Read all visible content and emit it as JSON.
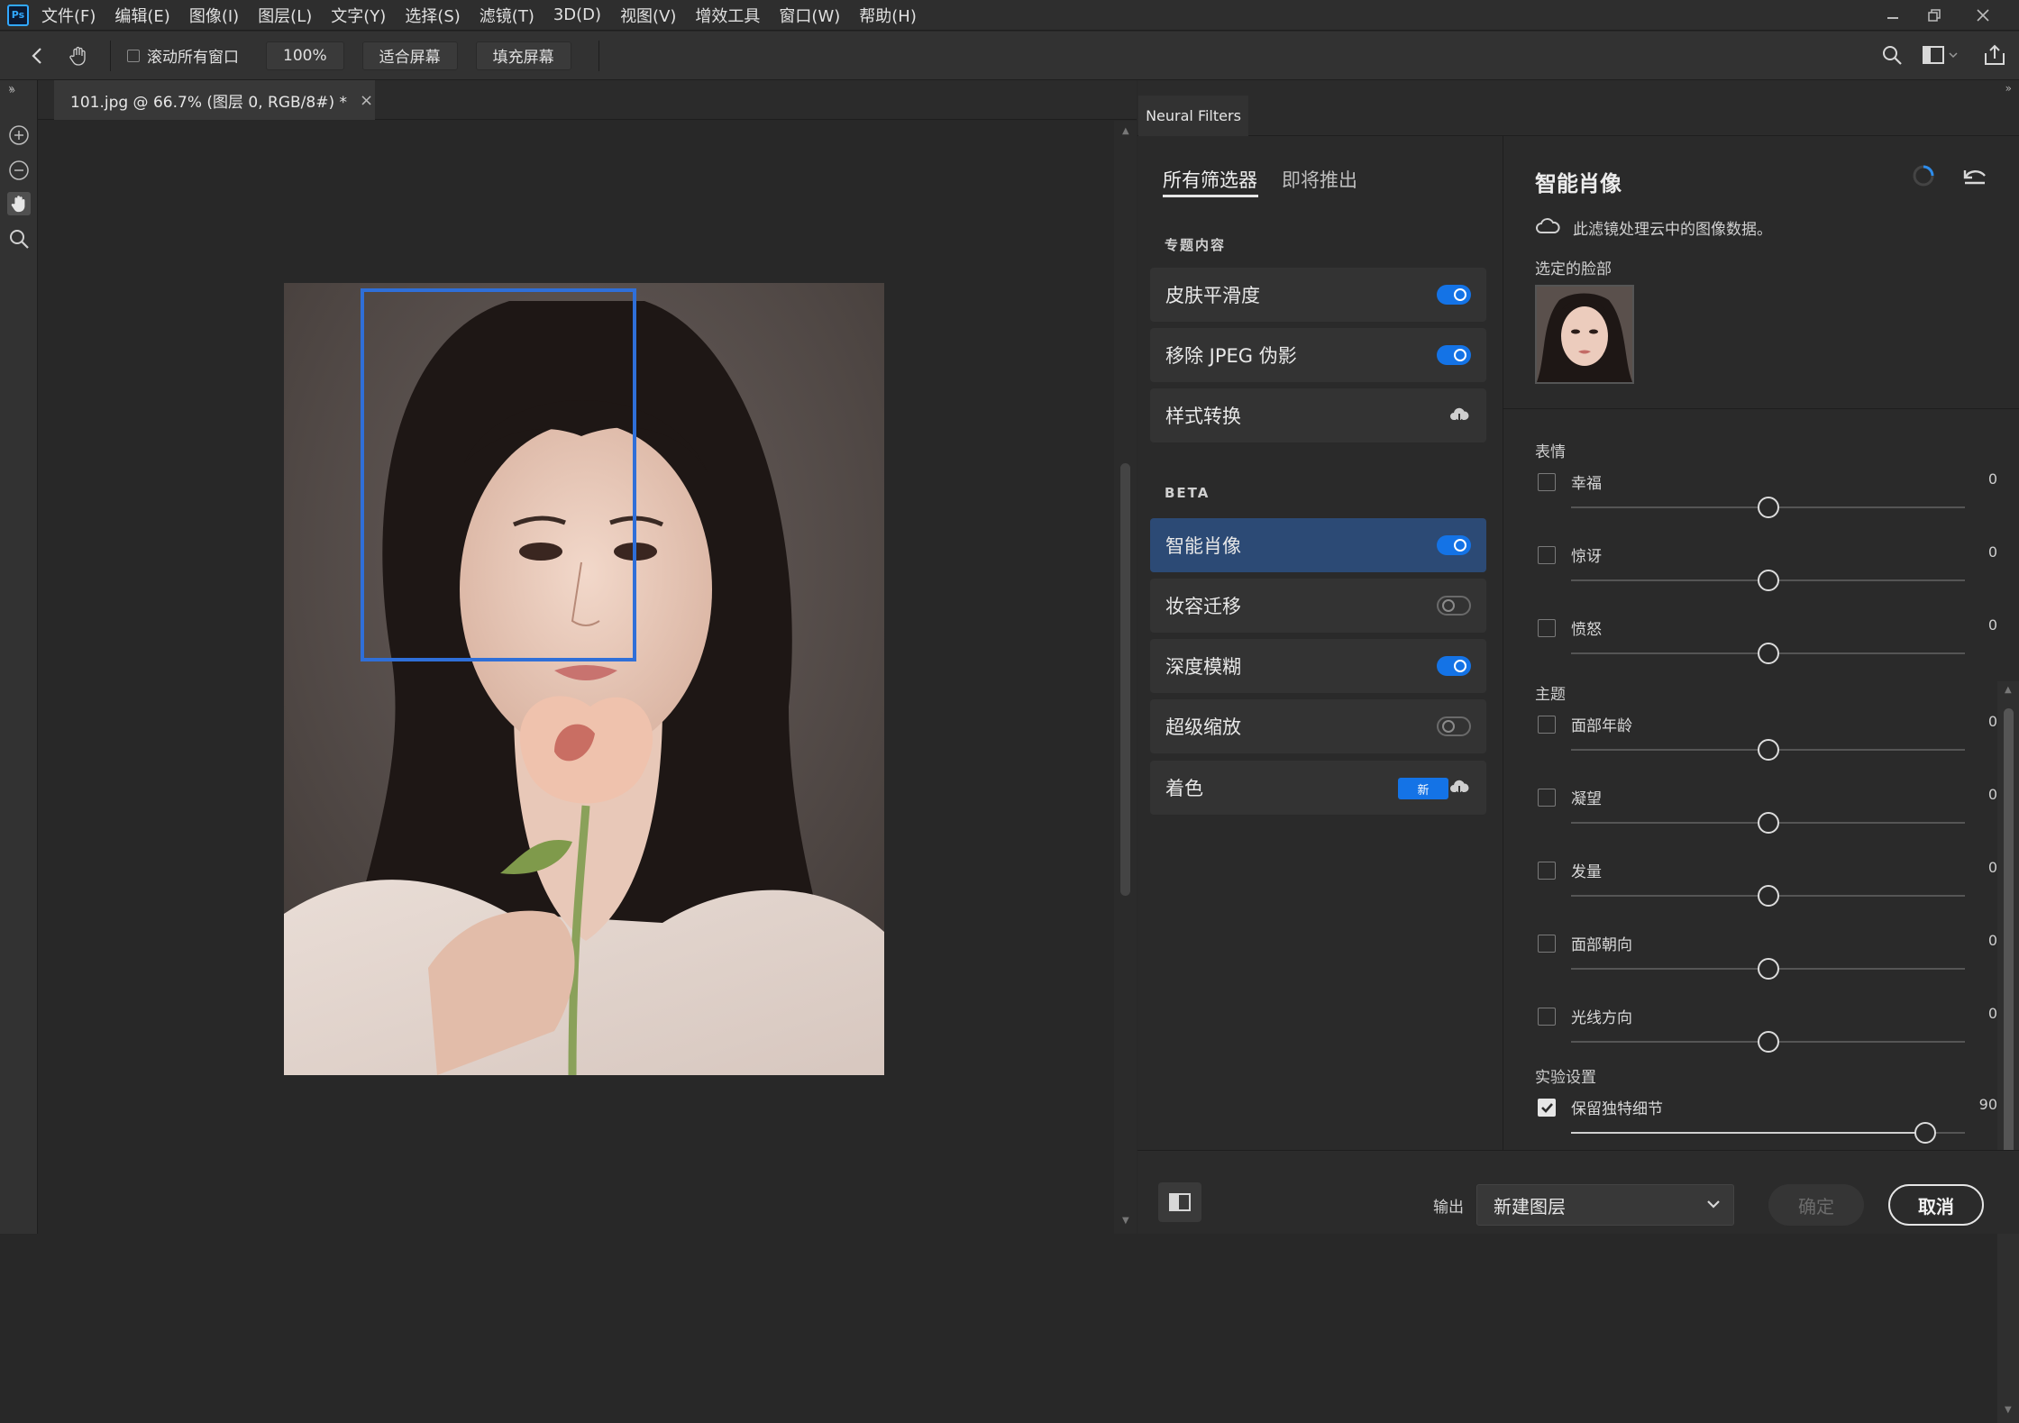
{
  "menubar": {
    "logo": "Ps",
    "items": [
      "文件(F)",
      "编辑(E)",
      "图像(I)",
      "图层(L)",
      "文字(Y)",
      "选择(S)",
      "滤镜(T)",
      "3D(D)",
      "视图(V)",
      "增效工具",
      "窗口(W)",
      "帮助(H)"
    ]
  },
  "optionsbar": {
    "scroll_all_label": "滚动所有窗口",
    "zoom_btn": "100%",
    "fit_btn": "适合屏幕",
    "fill_btn": "填充屏幕"
  },
  "document": {
    "tab_title": "101.jpg @ 66.7% (图层 0, RGB/8#) *",
    "close": "×"
  },
  "panel": {
    "tab": "Neural Filters",
    "filter_tabs": [
      "所有筛选器",
      "即将推出"
    ],
    "featured_label": "专题内容",
    "featured": [
      {
        "label": "皮肤平滑度",
        "state": "on"
      },
      {
        "label": "移除 JPEG 伪影",
        "state": "on"
      },
      {
        "label": "样式转换",
        "state": "cloud"
      }
    ],
    "beta_label": "BETA",
    "beta": [
      {
        "label": "智能肖像",
        "state": "on",
        "selected": true
      },
      {
        "label": "妆容迁移",
        "state": "off"
      },
      {
        "label": "深度模糊",
        "state": "on"
      },
      {
        "label": "超级缩放",
        "state": "off"
      },
      {
        "label": "着色",
        "state": "cloud",
        "badge": "新"
      }
    ]
  },
  "detail": {
    "title": "智能肖像",
    "cloud_note": "此滤镜处理云中的图像数据。",
    "selected_face_label": "选定的脸部",
    "group_expression": "表情",
    "group_theme": "主题",
    "group_experimental": "实验设置",
    "expression": [
      {
        "name": "幸福",
        "value": "0",
        "level": 0.5,
        "checked": false
      },
      {
        "name": "惊讶",
        "value": "0",
        "level": 0.5,
        "checked": false
      },
      {
        "name": "愤怒",
        "value": "0",
        "level": 0.5,
        "checked": false
      }
    ],
    "theme": [
      {
        "name": "面部年龄",
        "value": "0",
        "level": 0.5,
        "checked": false
      },
      {
        "name": "凝望",
        "value": "0",
        "level": 0.5,
        "checked": false
      },
      {
        "name": "发量",
        "value": "0",
        "level": 0.5,
        "checked": false
      },
      {
        "name": "面部朝向",
        "value": "0",
        "level": 0.5,
        "checked": false
      },
      {
        "name": "光线方向",
        "value": "0",
        "level": 0.5,
        "checked": false
      }
    ],
    "experimental": [
      {
        "name": "保留独特细节",
        "value": "90",
        "level": 0.9,
        "checked": true
      }
    ]
  },
  "footer": {
    "output_label": "输出",
    "output_value": "新建图层",
    "ok": "确定",
    "cancel": "取消"
  },
  "colors": {
    "accent": "#1473e6",
    "selected_item": "#2c4a75",
    "face_box": "#2f6fd8"
  }
}
